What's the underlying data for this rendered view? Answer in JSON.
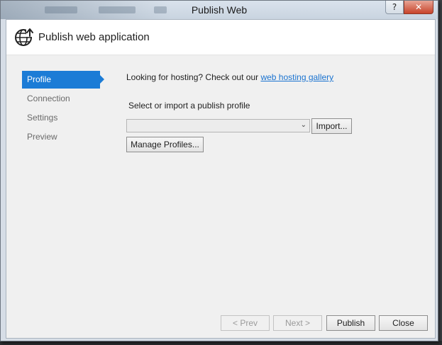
{
  "window": {
    "title": "Publish Web",
    "help_glyph": "?",
    "close_glyph": "✕"
  },
  "header": {
    "title": "Publish web application",
    "icon": "globe-publish-icon"
  },
  "nav": {
    "items": [
      {
        "label": "Profile",
        "active": true
      },
      {
        "label": "Connection",
        "active": false
      },
      {
        "label": "Settings",
        "active": false
      },
      {
        "label": "Preview",
        "active": false
      }
    ]
  },
  "main": {
    "hosting_text": "Looking for hosting? Check out our ",
    "hosting_link": "web hosting gallery",
    "select_label": "Select or import a publish profile",
    "profile_value": "",
    "import_label": "Import...",
    "manage_label": "Manage Profiles..."
  },
  "footer": {
    "prev_label": "< Prev",
    "next_label": "Next >",
    "publish_label": "Publish",
    "close_label": "Close"
  },
  "colors": {
    "accent": "#1c7cd6",
    "link": "#1a73d0",
    "close_button": "#c7432a"
  }
}
